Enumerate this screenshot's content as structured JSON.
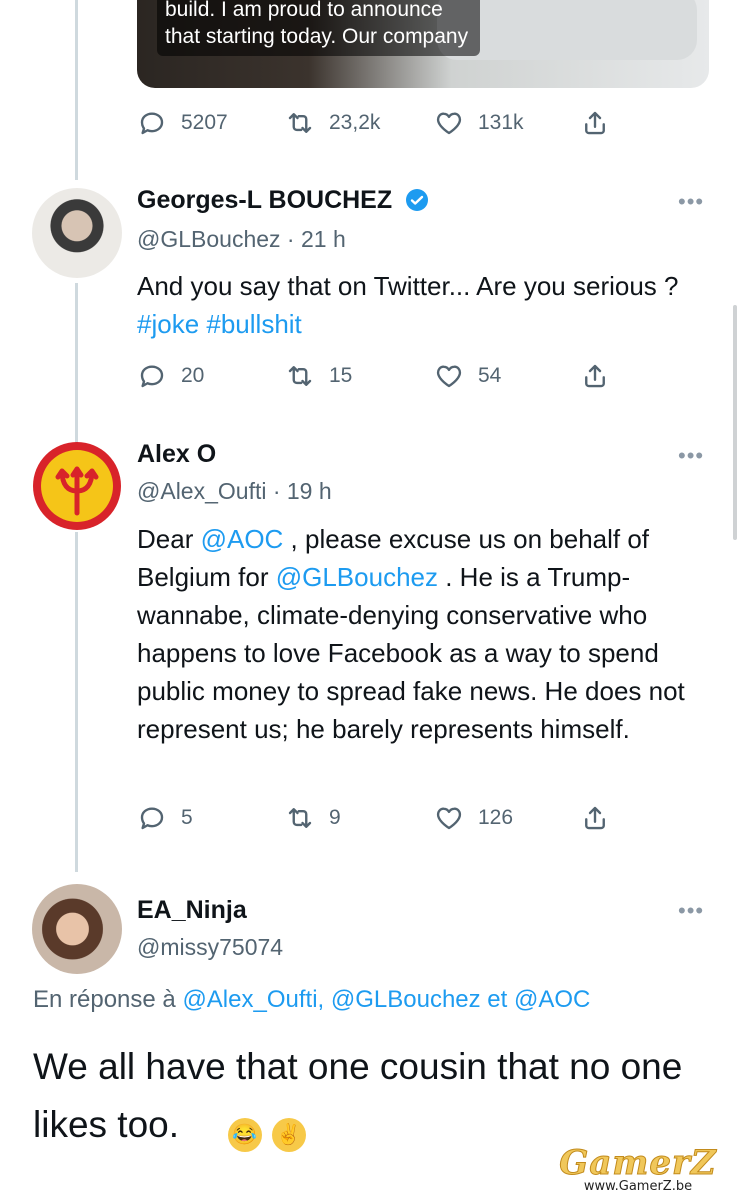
{
  "tweet0": {
    "media_caption_line1": "build. I am proud to announce",
    "media_caption_line2": "that starting today. Our company",
    "replies": "5207",
    "retweets": "23,2k",
    "likes": "131k"
  },
  "tweet1": {
    "name": "Georges-L BOUCHEZ",
    "handle": "@GLBouchez · 21 h",
    "text_part1": "And you say that on Twitter... Are you serious ? ",
    "hashtag1": "#joke",
    "hashtag2": "#bullshit",
    "replies": "20",
    "retweets": "15",
    "likes": "54"
  },
  "tweet2": {
    "name": "Alex O",
    "handle": "@Alex_Oufti · 19 h",
    "text_a": "Dear ",
    "mention1": "@AOC",
    "text_b": " , please excuse us on behalf of Belgium for ",
    "mention2": "@GLBouchez",
    "text_c": " . He is a Trump-wannabe, climate-denying conservative who happens to love Facebook as a way to spend public money to spread fake news. He does not represent us; he barely represents himself.",
    "replies": "5",
    "retweets": "9",
    "likes": "126"
  },
  "tweet3": {
    "name": "EA_Ninja",
    "handle": "@missy75074",
    "reply_prefix": "En réponse à ",
    "reply_mentions": "@Alex_Oufti, @GLBouchez et @AOC",
    "text": "We all have that one cousin that no one likes too."
  },
  "watermark": {
    "logo": "GamerZ",
    "url": "www.GamerZ.be"
  },
  "icons": {
    "reply": "reply-icon",
    "retweet": "retweet-icon",
    "like": "heart-icon",
    "share": "share-icon",
    "more": "more-icon",
    "verified": "verified-badge-icon"
  },
  "colors": {
    "link": "#1d9bf0",
    "secondary_text": "#536471",
    "thread_line": "#cfd9de"
  }
}
